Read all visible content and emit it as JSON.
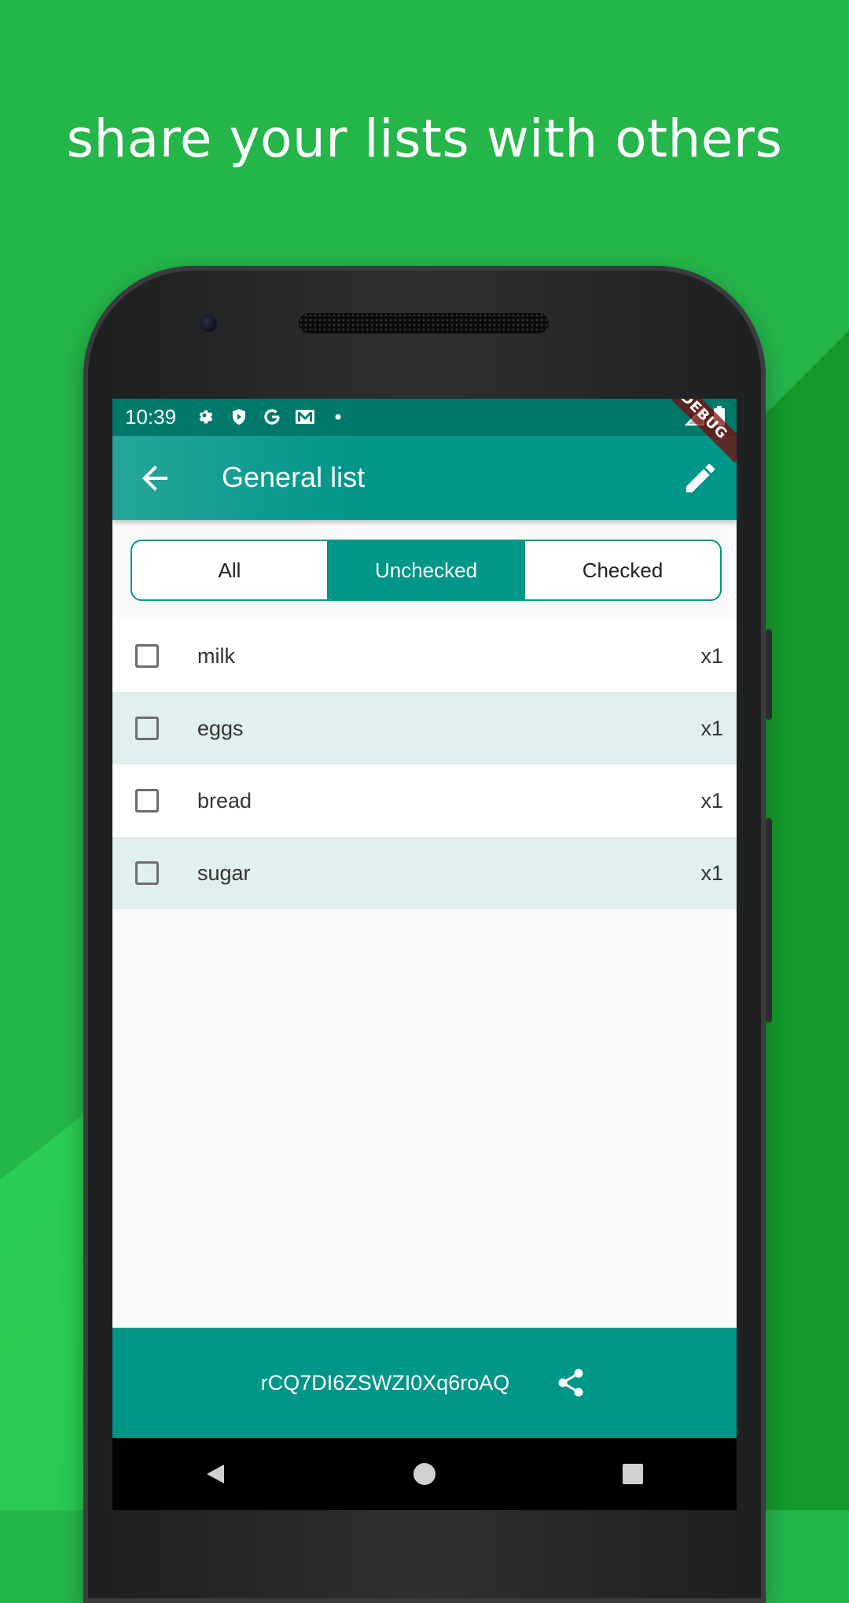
{
  "headline": "share your lists with others",
  "status_bar": {
    "time": "10:39",
    "icons": [
      "settings-icon",
      "shield-icon",
      "google-icon",
      "mail-icon",
      "dot-icon"
    ],
    "right_icons": [
      "signal-icon",
      "battery-icon"
    ]
  },
  "app_bar": {
    "title": "General list",
    "debug_label": "DEBUG"
  },
  "filter_tabs": [
    {
      "label": "All",
      "active": false
    },
    {
      "label": "Unchecked",
      "active": true
    },
    {
      "label": "Checked",
      "active": false
    }
  ],
  "items": [
    {
      "name": "milk",
      "qty": "x1",
      "checked": false
    },
    {
      "name": "eggs",
      "qty": "x1",
      "checked": false
    },
    {
      "name": "bread",
      "qty": "x1",
      "checked": false
    },
    {
      "name": "sugar",
      "qty": "x1",
      "checked": false
    }
  ],
  "share": {
    "code": "rCQ7DI6ZSWZI0Xq6roAQ"
  },
  "colors": {
    "primary": "#009688",
    "status_bar": "#00796b",
    "background_green": "#25b64a"
  }
}
